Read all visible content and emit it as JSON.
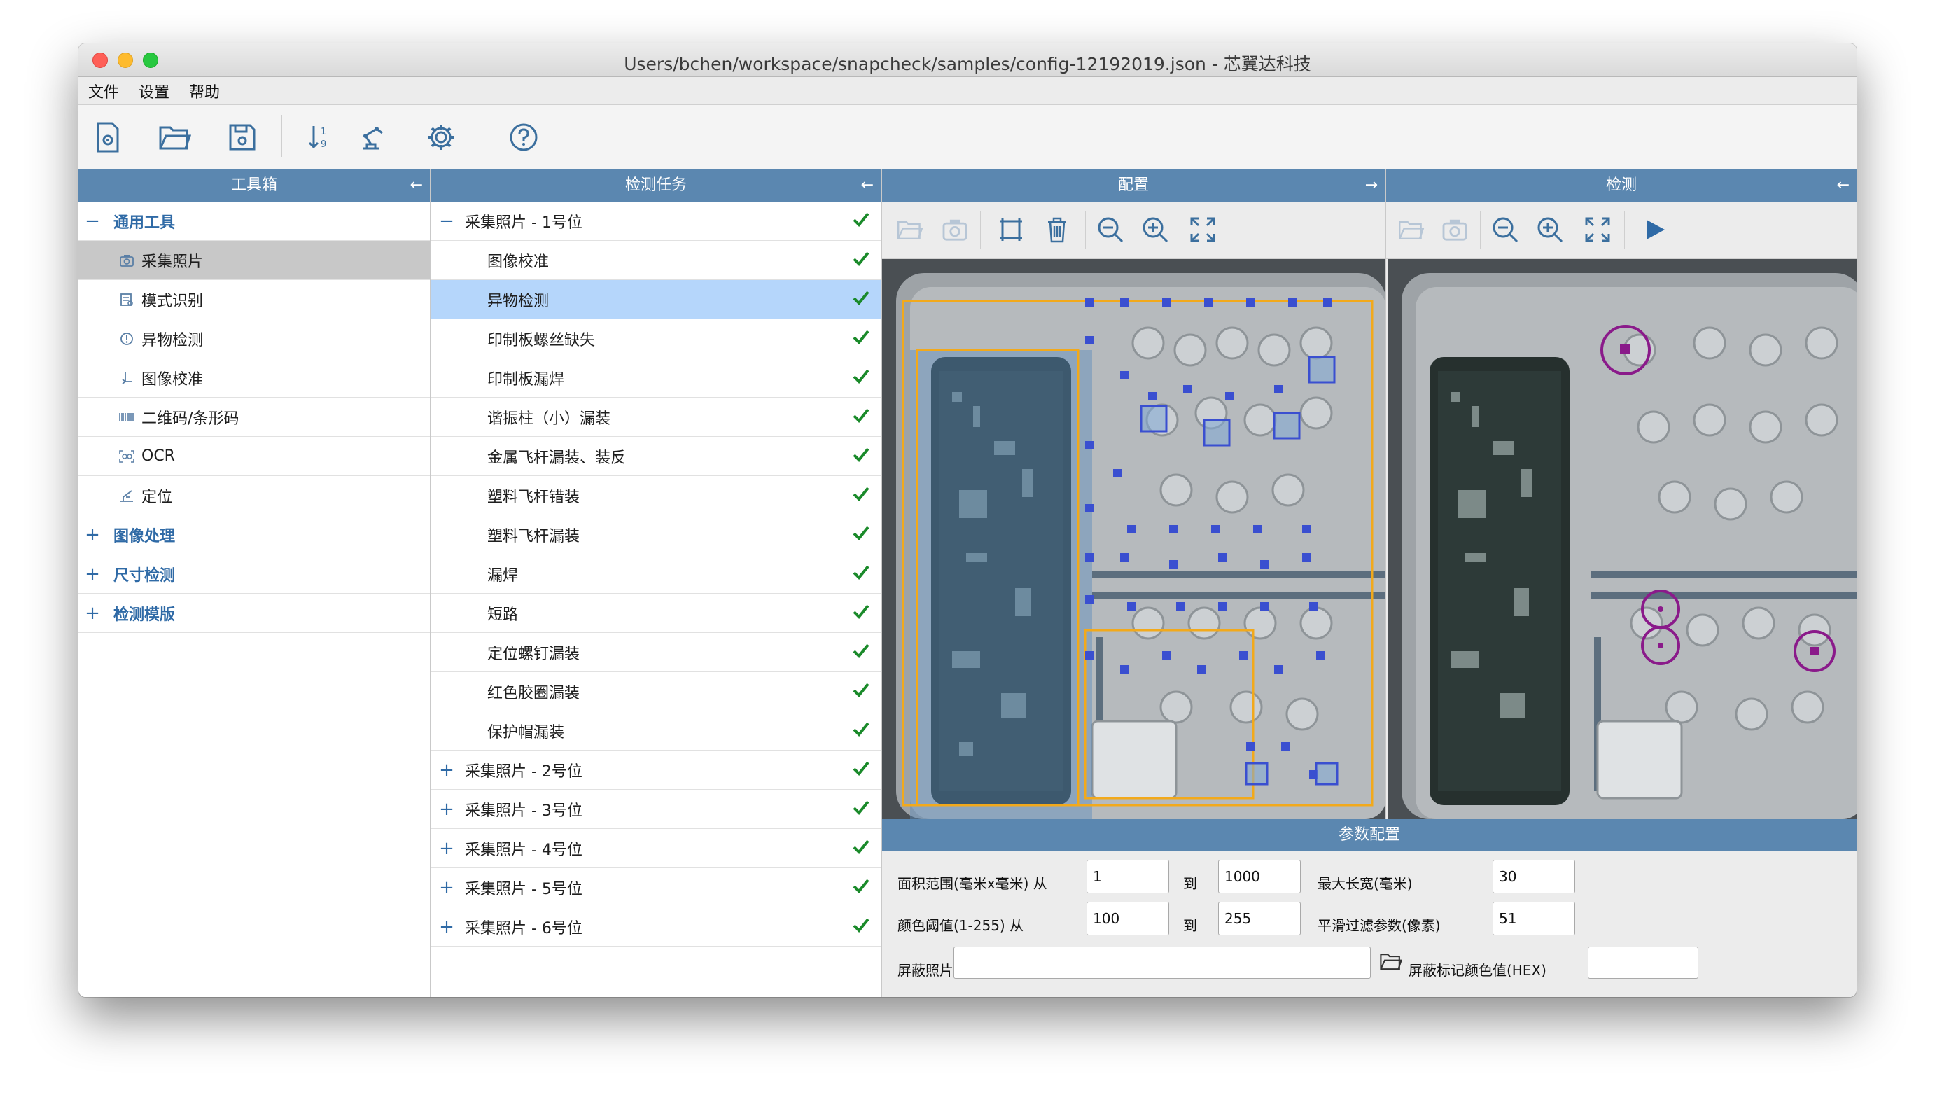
{
  "window": {
    "title": "Users/bchen/workspace/snapcheck/samples/config-12192019.json - 芯翼达科技"
  },
  "menu": [
    "文件",
    "设置",
    "帮助"
  ],
  "toolbar": {
    "buttons": [
      "new-config-icon",
      "open-folder-icon",
      "save-icon",
      "sort-icon",
      "robot-arm-icon",
      "gear-icon",
      "help-icon"
    ]
  },
  "toolbox": {
    "header": "工具箱",
    "header_arrow": "←",
    "categories": [
      {
        "expander": "−",
        "label": "通用工具",
        "items": [
          {
            "label": "采集照片",
            "icon": "camera-icon"
          },
          {
            "label": "模式识别",
            "icon": "pattern-icon"
          },
          {
            "label": "异物检测",
            "icon": "alert-icon"
          },
          {
            "label": "图像校准",
            "icon": "calibrate-icon"
          },
          {
            "label": "二维码/条形码",
            "icon": "barcode-icon"
          },
          {
            "label": "OCR",
            "icon": "ocr-icon"
          },
          {
            "label": "定位",
            "icon": "locate-icon"
          }
        ]
      },
      {
        "expander": "+",
        "label": "图像处理"
      },
      {
        "expander": "+",
        "label": "尺寸检测"
      },
      {
        "expander": "+",
        "label": "检测模版"
      }
    ]
  },
  "tasks": {
    "header": "检测任务",
    "header_arrow": "←",
    "groups": [
      {
        "expander": "−",
        "label": "采集照片 - 1号位",
        "children": [
          "图像校准",
          "异物检测",
          "印制板螺丝缺失",
          "印制板漏焊",
          "谐振柱（小）漏装",
          "金属飞杆漏装、装反",
          "塑料飞杆错装",
          "塑料飞杆漏装",
          "漏焊",
          "短路",
          "定位螺钉漏装",
          "红色胶圈漏装",
          "保护帽漏装"
        ]
      },
      {
        "expander": "+",
        "label": "采集照片 - 2号位"
      },
      {
        "expander": "+",
        "label": "采集照片 - 3号位"
      },
      {
        "expander": "+",
        "label": "采集照片 - 4号位"
      },
      {
        "expander": "+",
        "label": "采集照片 - 5号位"
      },
      {
        "expander": "+",
        "label": "采集照片 - 6号位"
      }
    ]
  },
  "config_panel": {
    "header": "配置",
    "header_arrow": "→"
  },
  "detect_panel": {
    "header": "检测",
    "header_arrow": "←"
  },
  "params": {
    "header": "参数配置",
    "area_label": "面积范围(毫米x毫米) 从",
    "area_from": "1",
    "to_label": "到",
    "area_to": "1000",
    "max_len_label": "最大长宽(毫米)",
    "max_len": "30",
    "color_label": "颜色阈值(1-255) 从",
    "color_from": "100",
    "color_to": "255",
    "smooth_label": "平滑过滤参数(像素)",
    "smooth": "51",
    "mask_label": "屏蔽照片",
    "mask_value": "",
    "mask_color_label": "屏蔽标记颜色值(HEX)",
    "mask_color_value": ""
  },
  "colors": {
    "header_blue": "#5b87b0",
    "link_blue": "#2f6aa6",
    "check_green": "#1a8a2a",
    "select_blue": "#b5d6fb"
  }
}
